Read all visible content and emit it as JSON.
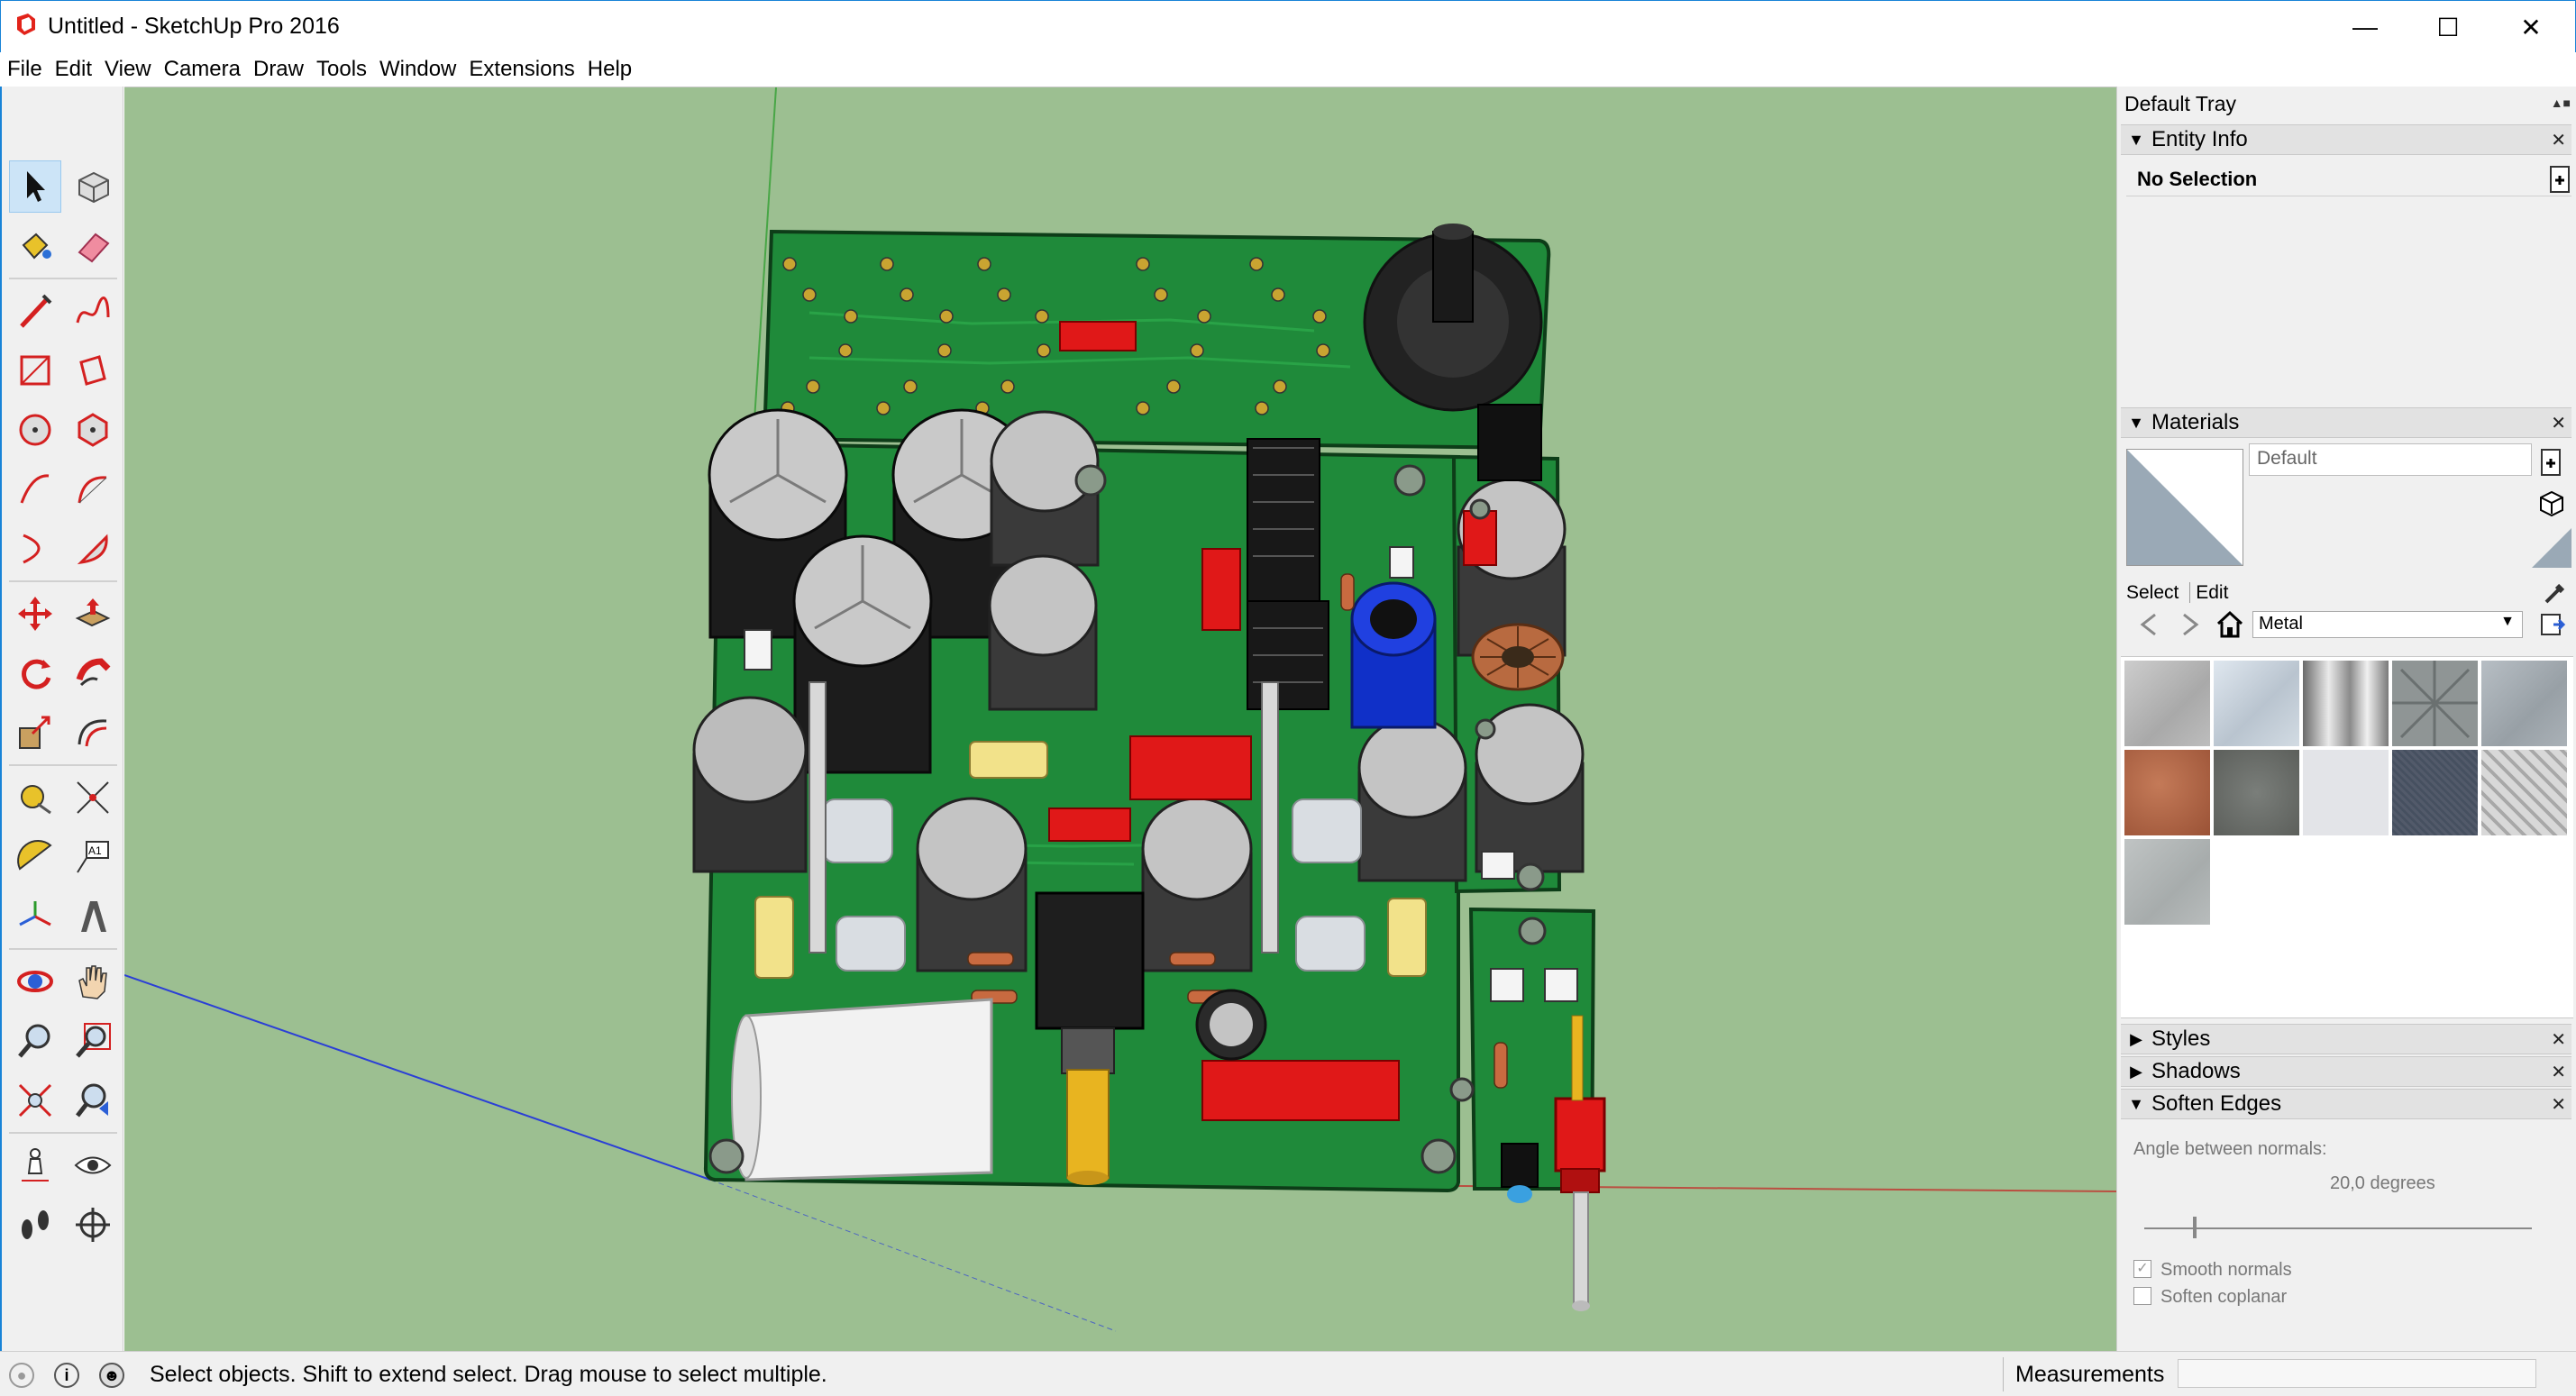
{
  "window": {
    "title": "Untitled - SketchUp Pro 2016"
  },
  "menu": [
    "File",
    "Edit",
    "View",
    "Camera",
    "Draw",
    "Tools",
    "Window",
    "Extensions",
    "Help"
  ],
  "tools": [
    "select-tool",
    "make-component-tool",
    "paint-bucket-tool",
    "eraser-tool",
    "line-tool",
    "freehand-tool",
    "rectangle-tool",
    "rotated-rectangle-tool",
    "circle-tool",
    "polygon-tool",
    "arc-tool",
    "two-point-arc-tool",
    "three-point-arc-tool",
    "pie-tool",
    "move-tool",
    "push-pull-tool",
    "rotate-tool",
    "follow-me-tool",
    "scale-tool",
    "offset-tool",
    "tape-measure-tool",
    "dimension-tool",
    "protractor-tool",
    "text-tool",
    "axes-tool",
    "3d-text-tool",
    "orbit-tool",
    "pan-tool",
    "zoom-tool",
    "zoom-window-tool",
    "zoom-extents-tool",
    "previous-view-tool",
    "position-camera-tool",
    "look-around-tool",
    "walk-tool",
    "section-plane-tool"
  ],
  "tray": {
    "title": "Default Tray",
    "entity_info": {
      "label": "Entity Info",
      "selection": "No Selection"
    },
    "materials": {
      "label": "Materials",
      "name": "Default",
      "tab_select": "Select",
      "tab_edit": "Edit",
      "library": "Metal",
      "swatches": [
        "#b9b9b9",
        "#c8d2dc",
        "#9a9a9a",
        "#8f9595",
        "#a9b0b6",
        "#b06a4a",
        "#6d706c",
        "#e3e4e8",
        "#525a6a",
        "#c6c6c6",
        "#aeb3b3"
      ]
    },
    "styles": {
      "label": "Styles"
    },
    "shadows": {
      "label": "Shadows"
    },
    "soften_edges": {
      "label": "Soften Edges",
      "angle_label": "Angle between normals:",
      "angle_value": "20,0  degrees",
      "smooth_normals": "Smooth normals",
      "soften_coplanar": "Soften coplanar"
    }
  },
  "status": {
    "message": "Select objects. Shift to extend select. Drag mouse to select multiple.",
    "measurements_label": "Measurements"
  },
  "colors": {
    "viewport_bg": "#9cbf91",
    "pcb_green": "#1f8a3a",
    "accent": "#1883d7"
  }
}
